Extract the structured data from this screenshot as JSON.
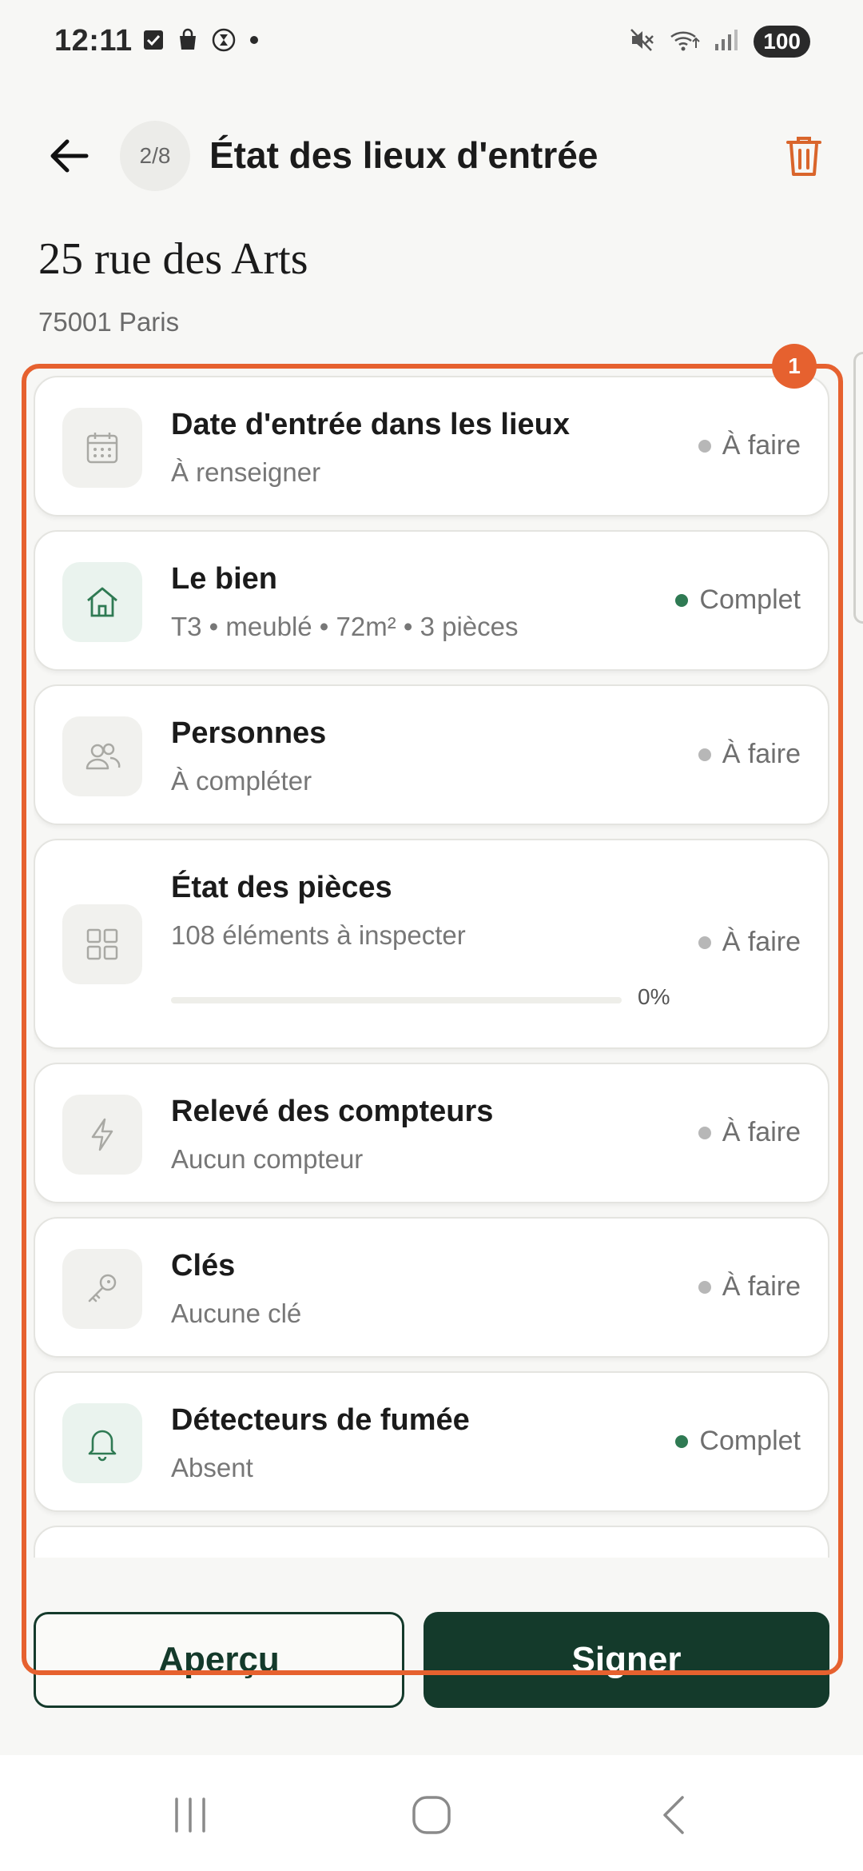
{
  "status_bar": {
    "time": "12:11",
    "battery": "100",
    "icons": [
      "check-box-icon",
      "shopping-bag-icon",
      "timer-icon",
      "dot-icon",
      "mute-icon",
      "wifi-icon",
      "signal-icon"
    ]
  },
  "header": {
    "step": "2/8",
    "title": "État des lieux d'entrée"
  },
  "property": {
    "address": "25 rue des Arts",
    "city": "75001 Paris"
  },
  "sections": [
    {
      "title": "Date d'entrée dans les lieux",
      "subtitle": "À renseigner",
      "status": "À faire",
      "icon": "calendar-icon"
    },
    {
      "title": "Le bien",
      "subtitle": "T3 • meublé • 72m² • 3 pièces",
      "status": "Complet",
      "icon": "house-icon"
    },
    {
      "title": "Personnes",
      "subtitle": "À compléter",
      "status": "À faire",
      "icon": "people-icon"
    },
    {
      "title": "État des pièces",
      "subtitle": "108 éléments à inspecter",
      "status": "À faire",
      "icon": "grid-icon",
      "progress": 0,
      "progress_label": "0%"
    },
    {
      "title": "Relevé des compteurs",
      "subtitle": "Aucun compteur",
      "status": "À faire",
      "icon": "lightning-icon"
    },
    {
      "title": "Clés",
      "subtitle": "Aucune clé",
      "status": "À faire",
      "icon": "key-icon"
    },
    {
      "title": "Détecteurs de fumée",
      "subtitle": "Absent",
      "status": "Complet",
      "icon": "bell-icon"
    }
  ],
  "actions": {
    "preview": "Aperçu",
    "sign": "Signer"
  },
  "annotation": {
    "badge": "1"
  },
  "colors": {
    "accent_dark": "#143a2b",
    "complete_green": "#2f7a53",
    "todo_gray": "#b7b7b7",
    "trash_orange": "#d9652b",
    "highlight": "#e6612f"
  }
}
